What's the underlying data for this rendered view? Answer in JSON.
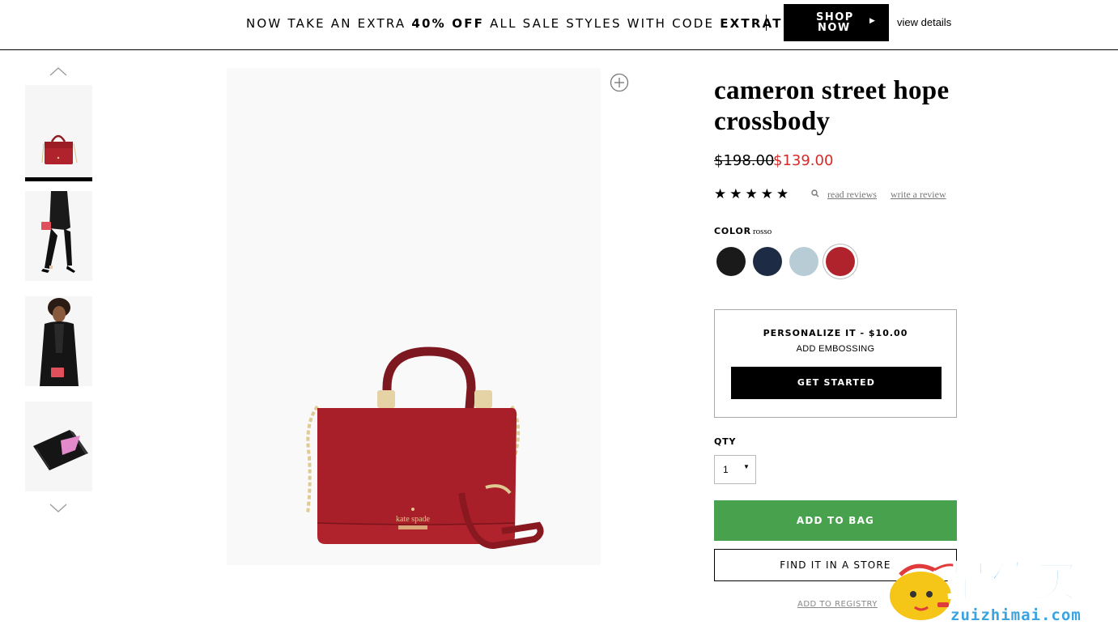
{
  "promo": {
    "text_pre": "NOW TAKE AN EXTRA ",
    "text_pct": "40% OFF",
    "text_mid": " ALL SALE STYLES WITH CODE ",
    "code": "EXTRATREAT",
    "shop_now_line1": "SHOP",
    "shop_now_line2": "NOW",
    "view_details": "view details"
  },
  "product": {
    "title": "cameron street hope crossbody",
    "price_original": "$198.00",
    "price_sale": "$139.00",
    "rating_stars": 5,
    "stars_text": "★★★★★",
    "read_reviews": "read reviews",
    "write_review": "write a review",
    "color_label": "COLOR",
    "color_selected": "rosso",
    "swatches": [
      {
        "name": "black",
        "hex": "#1a1a1a"
      },
      {
        "name": "navy",
        "hex": "#1e2b45"
      },
      {
        "name": "light blue",
        "hex": "#b8ccd6"
      },
      {
        "name": "rosso",
        "hex": "#b0222c"
      }
    ]
  },
  "personalize": {
    "title": "PERSONALIZE IT - $10.00",
    "subtitle": "ADD EMBOSSING",
    "button": "GET STARTED"
  },
  "qty": {
    "label": "QTY",
    "value": "1"
  },
  "actions": {
    "add_to_bag": "ADD TO BAG",
    "find_store": "FIND IT IN A STORE",
    "add_to_registry": "ADD TO REGISTRY"
  },
  "main_image": {
    "brand_stamp": "kate spade"
  },
  "watermark": {
    "text": "最值买",
    "sub": "zuizhimai.com"
  },
  "colors": {
    "sale_red": "#d62a2a",
    "add_bag_green": "#48a14d",
    "bag_red": "#b0222c"
  }
}
